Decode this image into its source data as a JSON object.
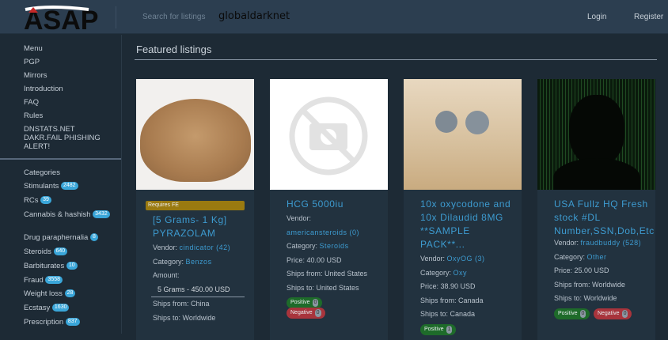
{
  "header": {
    "logo_text": "ASAP",
    "search_placeholder": "Search for listings",
    "watermark": "globaldarknet",
    "login": "Login",
    "register": "Register"
  },
  "sidebar": {
    "menu": [
      "Menu",
      "PGP",
      "Mirrors",
      "Introduction",
      "FAQ",
      "Rules",
      "DNSTATS.NET DAKR.FAIL PHISHING ALERT!"
    ],
    "categories_title": "Categories",
    "categories": [
      {
        "label": "Stimulants",
        "count": "2482"
      },
      {
        "label": "RCs",
        "count": "39"
      },
      {
        "label": "Cannabis & hashish",
        "count": "3432"
      },
      {
        "label": "Drug paraphernalia",
        "count": "8"
      },
      {
        "label": "Steroids",
        "count": "640"
      },
      {
        "label": "Barbiturates",
        "count": "10"
      },
      {
        "label": "Fraud",
        "count": "3558"
      },
      {
        "label": "Weight loss",
        "count": "28"
      },
      {
        "label": "Ecstasy",
        "count": "1630"
      },
      {
        "label": "Prescription",
        "count": "837"
      }
    ]
  },
  "main": {
    "title": "Featured listings",
    "listings": [
      {
        "badge": "Requires FE",
        "title": "[5 Grams- 1 Kg] PYRAZOLAM",
        "vendor_label": "Vendor:",
        "vendor": "cindicator (42)",
        "category_label": "Category:",
        "category": "Benzos",
        "amount_label": "Amount:",
        "amount": "5 Grams - 450.00 USD",
        "ships_from": "Ships from: China",
        "ships_to": "Ships to: Worldwide"
      },
      {
        "title": "HCG 5000iu",
        "vendor_label": "Vendor:",
        "vendor": "americansteroids (0)",
        "category_label": "Category:",
        "category": "Steroids",
        "price": "Price: 40.00 USD",
        "ships_from": "Ships from: United States",
        "ships_to": "Ships to: United States",
        "positive": "Positive",
        "positive_count": "0",
        "negative": "Negative",
        "negative_count": "0"
      },
      {
        "title": "10x oxycodone and 10x Dilaudid 8MG **SAMPLE PACK**...",
        "vendor_label": "Vendor:",
        "vendor": "OxyOG (3)",
        "category_label": "Category:",
        "category": "Oxy",
        "price": "Price: 38.90 USD",
        "ships_from": "Ships from: Canada",
        "ships_to": "Ships to: Canada",
        "positive": "Positive",
        "positive_count": "1"
      },
      {
        "title": "USA Fullz HQ Fresh stock #DL Number,SSN,Dob,Etc",
        "vendor_label": "Vendor:",
        "vendor": "fraudbuddy (528)",
        "category_label": "Category:",
        "category": "Other",
        "price": "Price: 25.00 USD",
        "ships_from": "Ships from: Worldwide",
        "ships_to": "Ships to: Worldwide",
        "positive": "Positive",
        "positive_count": "0",
        "negative": "Negative",
        "negative_count": "0"
      }
    ]
  }
}
